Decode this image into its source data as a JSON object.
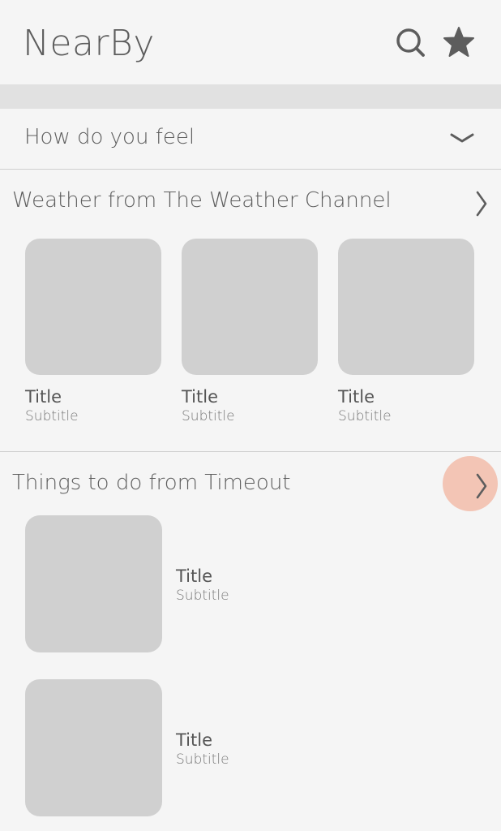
{
  "header": {
    "app_title": "NearBy",
    "search_icon": "search-icon",
    "favorite_icon": "star-icon"
  },
  "mood": {
    "label": "How do you feel",
    "icon": "chevron-down-icon"
  },
  "weather_section": {
    "title": "Weather from The Weather Channel",
    "icon": "chevron-right-icon",
    "cards": [
      {
        "title": "Title",
        "subtitle": "Subtitle"
      },
      {
        "title": "Title",
        "subtitle": "Subtitle"
      },
      {
        "title": "Title",
        "subtitle": "Subtitle"
      }
    ]
  },
  "things_section": {
    "title": "Things to do from Timeout",
    "icon": "chevron-right-icon",
    "items": [
      {
        "title": "Title",
        "subtitle": "Subtitle"
      },
      {
        "title": "Title",
        "subtitle": "Subtitle"
      }
    ]
  },
  "colors": {
    "background": "#f5f5f5",
    "placeholder": "#d0d0d0",
    "highlight": "#f3c5b5",
    "text": "#5d5d5d"
  }
}
